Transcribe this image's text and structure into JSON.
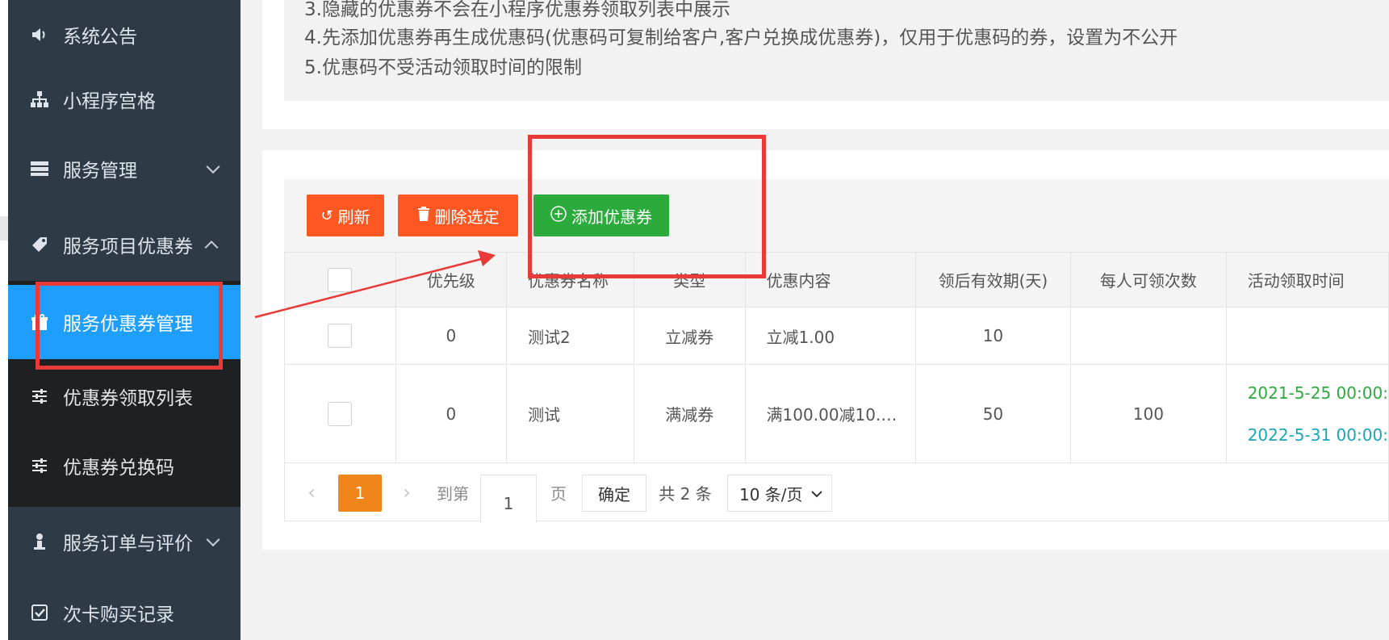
{
  "sidebar": {
    "items": [
      {
        "label": "系统公告",
        "icon": "volume-icon"
      },
      {
        "label": "小程序宫格",
        "icon": "sitemap-icon"
      },
      {
        "label": "服务管理",
        "icon": "server-icon"
      },
      {
        "label": "服务项目优惠券",
        "icon": "ticket-icon"
      },
      {
        "label": "服务优惠券管理",
        "icon": "gift-icon"
      },
      {
        "label": "优惠券领取列表",
        "icon": "sliders-icon"
      },
      {
        "label": "优惠券兑换码",
        "icon": "sliders-icon"
      },
      {
        "label": "服务订单与评价",
        "icon": "user-icon"
      },
      {
        "label": "次卡购买记录",
        "icon": "check-square-icon"
      }
    ]
  },
  "notice": {
    "line3": "3.隐藏的优惠券不会在小程序优惠券领取列表中展示",
    "line4": "4.先添加优惠券再生成优惠码(优惠码可复制给客户,客户兑换成优惠券)，仅用于优惠码的券，设置为不公开",
    "line5": "5.优惠码不受活动领取时间的限制"
  },
  "toolbar": {
    "refresh": "刷新",
    "delete_selected": "删除选定",
    "add_coupon": "添加优惠券"
  },
  "table": {
    "headers": [
      "优先级",
      "优惠券名称",
      "类型",
      "优惠内容",
      "领后有效期(天)",
      "每人可领次数",
      "活动领取时间"
    ],
    "rows": [
      {
        "priority": "0",
        "name": "测试2",
        "type": "立减券",
        "content": "立减1.00",
        "valid_days": "10",
        "per_person": "",
        "start": "",
        "end": ""
      },
      {
        "priority": "0",
        "name": "测试",
        "type": "满减券",
        "content": "满100.00减10.…",
        "valid_days": "50",
        "per_person": "100",
        "start": "2021-5-25 00:00:",
        "end": "2022-5-31 00:00:"
      }
    ]
  },
  "pager": {
    "current": "1",
    "goto_label": "到第",
    "goto_value": "1",
    "page_label": "页",
    "confirm": "确定",
    "total": "共 2 条",
    "per_page": "10 条/页"
  },
  "colors": {
    "sidebar_bg": "#2f3a47",
    "active": "#1e9fff",
    "orange_btn": "#ff5722",
    "green_btn": "#2bab3c",
    "highlight_red": "#e93a3a",
    "pager_orange": "#f0861a"
  }
}
